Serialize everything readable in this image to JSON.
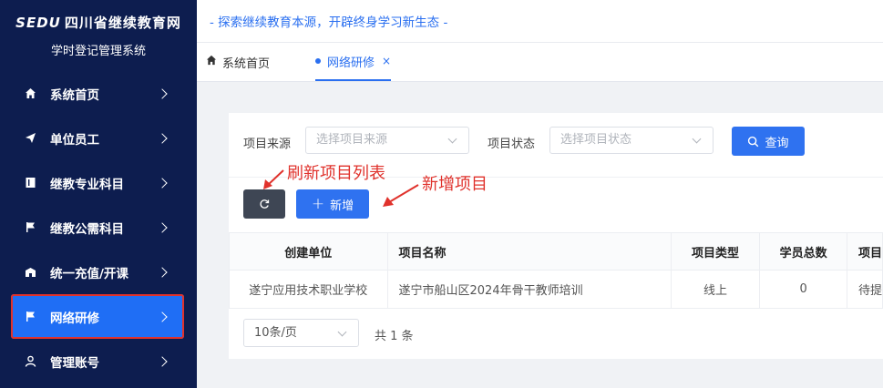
{
  "brand": {
    "logo_text": "SEDU",
    "title": "四川省继续教育网",
    "subtitle": "学时登记管理系统"
  },
  "sidebar": {
    "items": [
      {
        "label": "系统首页",
        "icon": "home-icon"
      },
      {
        "label": "单位员工",
        "icon": "send-icon"
      },
      {
        "label": "继教专业科目",
        "icon": "book-icon"
      },
      {
        "label": "继教公需科目",
        "icon": "flag-icon"
      },
      {
        "label": "统一充值/开课",
        "icon": "shop-icon"
      },
      {
        "label": "网络研修",
        "icon": "flag-icon",
        "active": true
      },
      {
        "label": "管理账号",
        "icon": "user-icon"
      }
    ]
  },
  "header": {
    "slogan": "- 探索继续教育本源，开辟终身学习新生态 -"
  },
  "tabs": [
    {
      "label": "系统首页",
      "icon": "home-icon"
    },
    {
      "label": "网络研修",
      "active": true,
      "close": "×"
    }
  ],
  "filters": {
    "source_label": "项目来源",
    "source_placeholder": "选择项目来源",
    "status_label": "项目状态",
    "status_placeholder": "选择项目状态",
    "query_label": "查询"
  },
  "toolbar": {
    "add_label": "新增"
  },
  "annotations": {
    "refresh": "刷新项目列表",
    "add": "新增项目"
  },
  "table": {
    "columns": [
      "创建单位",
      "项目名称",
      "项目类型",
      "学员总数",
      "项目"
    ],
    "rows": [
      [
        "遂宁应用技术职业学校",
        "遂宁市船山区2024年骨干教师培训",
        "线上",
        "0",
        "待提"
      ]
    ]
  },
  "pagination": {
    "page_size": "10条/页",
    "total": "共 1 条"
  },
  "colors": {
    "primary": "#2f72f0",
    "sidebar_bg": "#0d1d4f",
    "annotation": "#e0322c",
    "dark_button": "#3e4654"
  }
}
